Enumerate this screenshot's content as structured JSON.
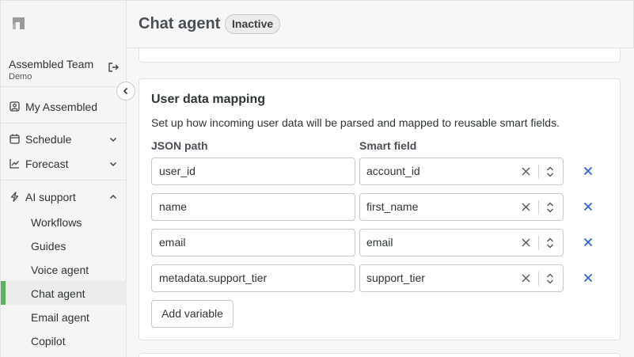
{
  "sidebar": {
    "team_name": "Assembled Team",
    "team_sub": "Demo",
    "items": {
      "my_assembled": "My Assembled",
      "schedule": "Schedule",
      "forecast": "Forecast",
      "ai_support": "AI support"
    },
    "ai_support_children": {
      "workflows": "Workflows",
      "guides": "Guides",
      "voice_agent": "Voice agent",
      "chat_agent": "Chat agent",
      "email_agent": "Email agent",
      "copilot": "Copilot"
    },
    "active_item": "Chat agent",
    "accent_color": "#5ab25b"
  },
  "header": {
    "title": "Chat agent",
    "status": "Inactive"
  },
  "mapping": {
    "title": "User data mapping",
    "description": "Set up how incoming user data will be parsed and mapped to reusable smart fields.",
    "col_json": "JSON path",
    "col_smart": "Smart field",
    "rows": [
      {
        "json_path": "user_id",
        "smart_field": "account_id"
      },
      {
        "json_path": "name",
        "smart_field": "first_name"
      },
      {
        "json_path": "email",
        "smart_field": "email"
      },
      {
        "json_path": "metadata.support_tier",
        "smart_field": "support_tier"
      }
    ],
    "add_label": "Add variable",
    "remove_color": "#2b63d9"
  }
}
